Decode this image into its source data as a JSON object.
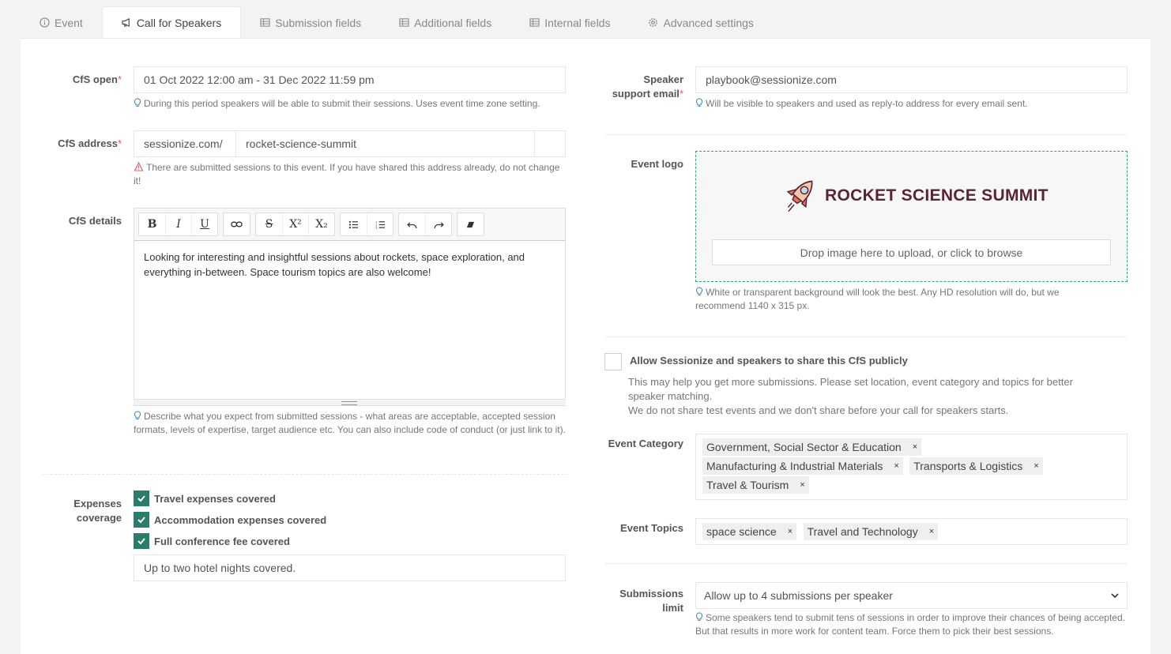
{
  "tabs": [
    {
      "label": "Event",
      "icon": "info-icon"
    },
    {
      "label": "Call for Speakers",
      "icon": "megaphone-icon"
    },
    {
      "label": "Submission fields",
      "icon": "table-icon"
    },
    {
      "label": "Additional fields",
      "icon": "table-icon"
    },
    {
      "label": "Internal fields",
      "icon": "table-icon"
    },
    {
      "label": "Advanced settings",
      "icon": "gear-icon"
    }
  ],
  "cfs_open": {
    "label": "CfS open",
    "required": "*",
    "value": "01 Oct 2022 12:00 am - 31 Dec 2022 11:59 pm",
    "help": "During this period speakers will be able to submit their sessions. Uses event time zone setting."
  },
  "cfs_address": {
    "label": "CfS address",
    "required": "*",
    "prefix": "sessionize.com/",
    "value": "rocket-science-summit",
    "warning": "There are submitted sessions to this event. If you have shared this address already, do not change it!"
  },
  "cfs_details": {
    "label": "CfS details",
    "toolbar": [
      "B",
      "I",
      "U",
      "link",
      "S",
      "X²",
      "X₂",
      "bullets",
      "numbers",
      "undo",
      "redo",
      "clear"
    ],
    "text": "Looking for interesting and insightful sessions about rockets, space exploration, and everything in-between. Space tourism topics are also welcome!",
    "help": "Describe what you expect from submitted sessions - what areas are acceptable, accepted session formats, levels of expertise, target audience etc. You can also include code of conduct (or just link to it)."
  },
  "expenses": {
    "label_line1": "Expenses",
    "label_line2": "coverage",
    "items": [
      "Travel expenses covered",
      "Accommodation expenses covered",
      "Full conference fee covered"
    ],
    "note": "Up to two hotel nights covered."
  },
  "support_email": {
    "label_line1": "Speaker",
    "label_line2": "support email",
    "required": "*",
    "value": "playbook@sessionize.com",
    "help": "Will be visible to speakers and used as reply-to address for every email sent."
  },
  "event_logo": {
    "label": "Event logo",
    "logo_text": "ROCKET SCIENCE SUMMIT",
    "drop_label": "Drop image here to upload, or click to browse",
    "help": "White or transparent background will look the best. Any HD resolution will do, but we recommend 1140 x 315 px."
  },
  "share": {
    "label": "Allow Sessionize and speakers to share this CfS publicly",
    "desc1": "This may help you get more submissions. Please set location, event category and topics for better speaker matching.",
    "desc2": "We do not share test events and we don't share before your call for speakers starts."
  },
  "event_category": {
    "label": "Event Category",
    "tags": [
      "Government, Social Sector & Education",
      "Manufacturing & Industrial Materials",
      "Transports & Logistics",
      "Travel & Tourism"
    ]
  },
  "event_topics": {
    "label": "Event Topics",
    "tags": [
      "space science",
      "Travel and Technology"
    ]
  },
  "submissions_limit": {
    "label_line1": "Submissions",
    "label_line2": "limit",
    "value": "Allow up to 4 submissions per speaker",
    "help": "Some speakers tend to submit tens of sessions in order to improve their chances of being accepted. But that results in more work for content team. Force them to pick their best sessions."
  },
  "remove_glyph": "×",
  "colors": {
    "accent": "#2a7d6a",
    "required": "#ed5565",
    "logo": "#5a2436"
  }
}
